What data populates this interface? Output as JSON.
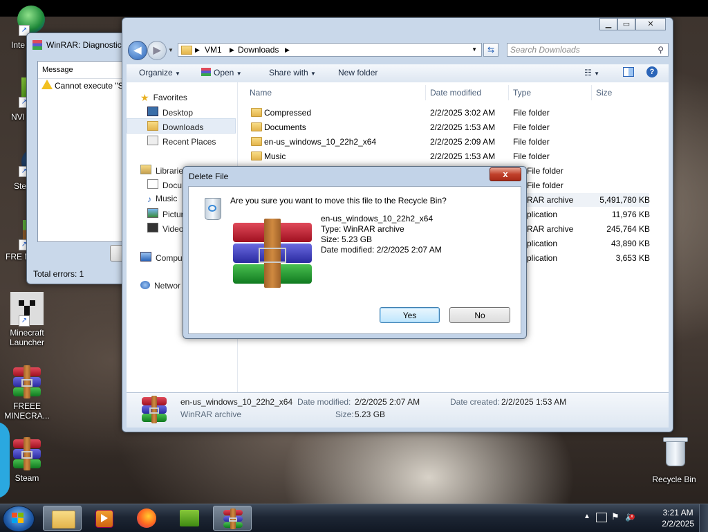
{
  "desktop": {
    "icons": [
      {
        "label": "Inte Dow",
        "name": "internet-download-manager"
      },
      {
        "label": "NVI GeF",
        "name": "nvidia-geforce"
      },
      {
        "label": "Ste",
        "name": "steam-top"
      },
      {
        "label": "FRE MINE",
        "name": "free-minecraft-top"
      },
      {
        "label": "Minecraft Launcher",
        "name": "minecraft-launcher"
      },
      {
        "label": "FREEE MINECRA...",
        "name": "freee-minecraft"
      },
      {
        "label": "Steam",
        "name": "steam"
      },
      {
        "label": "Recycle Bin",
        "name": "recycle-bin"
      }
    ]
  },
  "winrar_diag": {
    "title": "WinRAR: Diagnostic",
    "column_header": "Message",
    "message": "Cannot execute \"SE",
    "footer": "Total errors: 1"
  },
  "explorer": {
    "breadcrumb": [
      "VM1",
      "Downloads"
    ],
    "search_placeholder": "Search Downloads",
    "toolbar": {
      "organize": "Organize",
      "open": "Open",
      "share_with": "Share with",
      "new_folder": "New folder"
    },
    "nav": {
      "favorites": "Favorites",
      "desktop": "Desktop",
      "downloads": "Downloads",
      "recent_places": "Recent Places",
      "libraries": "Librarie",
      "documents": "Docu",
      "music": "Music",
      "pictures": "Pictur",
      "videos": "Video",
      "computer": "Compu",
      "network": "Networ"
    },
    "columns": {
      "name": "Name",
      "date_modified": "Date modified",
      "type": "Type",
      "size": "Size"
    },
    "rows": [
      {
        "name": "Compressed",
        "date": "2/2/2025 3:02 AM",
        "type": "File folder",
        "size": ""
      },
      {
        "name": "Documents",
        "date": "2/2/2025 1:53 AM",
        "type": "File folder",
        "size": ""
      },
      {
        "name": "en-us_windows_10_22h2_x64",
        "date": "2/2/2025 2:09 AM",
        "type": "File folder",
        "size": ""
      },
      {
        "name": "Music",
        "date": "2/2/2025 1:53 AM",
        "type": "File folder",
        "size": ""
      },
      {
        "name": "",
        "date": "",
        "type": "File folder",
        "size": ""
      },
      {
        "name": "",
        "date": "",
        "type": "File folder",
        "size": ""
      },
      {
        "name": "",
        "date": "",
        "type": "RAR archive",
        "size": "5,491,780 KB"
      },
      {
        "name": "",
        "date": "",
        "type": "plication",
        "size": "11,976 KB"
      },
      {
        "name": "",
        "date": "",
        "type": "RAR archive",
        "size": "245,764 KB"
      },
      {
        "name": "",
        "date": "",
        "type": "plication",
        "size": "43,890 KB"
      },
      {
        "name": "",
        "date": "",
        "type": "plication",
        "size": "3,653 KB"
      }
    ],
    "details": {
      "filename": "en-us_windows_10_22h2_x64",
      "filetype": "WinRAR archive",
      "date_modified_label": "Date modified:",
      "date_modified": "2/2/2025 2:07 AM",
      "date_created_label": "Date created:",
      "date_created": "2/2/2025 1:53 AM",
      "size_label": "Size:",
      "size": "5.23 GB"
    }
  },
  "delete_dialog": {
    "title": "Delete File",
    "close": "x",
    "question": "Are you sure you want to move this file to the Recycle Bin?",
    "file_name": "en-us_windows_10_22h2_x64",
    "file_type": "Type: WinRAR archive",
    "file_size": "Size: 5.23 GB",
    "file_date": "Date modified: 2/2/2025 2:07 AM",
    "yes": "Yes",
    "no": "No"
  },
  "taskbar": {
    "time": "3:21 AM",
    "date": "2/2/2025"
  }
}
